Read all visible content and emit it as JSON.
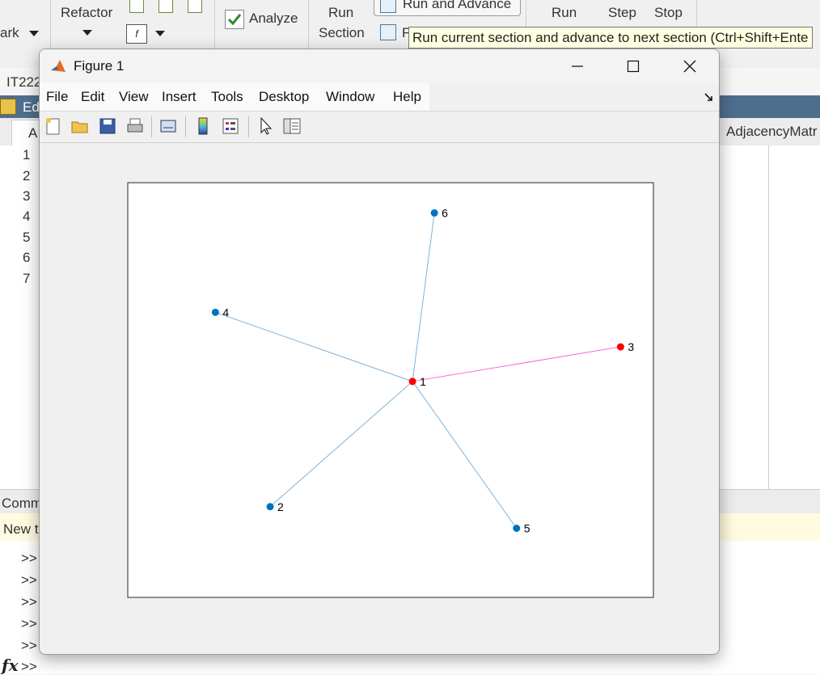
{
  "toolstrip": {
    "partial_left_label": "ark",
    "refactor_label": "Refactor",
    "analyze_label": "Analyze",
    "run_section_label_line1": "Run",
    "run_section_label_line2": "Section",
    "run_and_advance_label": "Run and Advance",
    "partial_run_to_end": "F",
    "run_label": "Run",
    "step_label": "Step",
    "stop_label": "Stop"
  },
  "tooltip": {
    "text": "Run current section and advance to next section (Ctrl+Shift+Ente"
  },
  "editor": {
    "file_tab_partial": "IT222",
    "editor_title_partial": "Ed",
    "tab_partial": "A",
    "variable_partial": "AdjacencyMatr",
    "line_numbers": [
      "1",
      "2",
      "3",
      "4",
      "5",
      "6",
      "7"
    ]
  },
  "command_window": {
    "header_partial": "Comm",
    "banner_partial": "New t",
    "prompts": [
      ">>",
      ">>",
      ">>",
      ">>",
      ">>",
      ">>"
    ],
    "fx_label": "fx"
  },
  "figure": {
    "title": "Figure 1",
    "menus": [
      "File",
      "Edit",
      "View",
      "Insert",
      "Tools",
      "Desktop",
      "Window",
      "Help"
    ],
    "toolbar_icons": [
      "new-figure-icon",
      "open-file-icon",
      "save-icon",
      "print-icon",
      "link-plot-icon",
      "colorbar-icon",
      "legend-icon",
      "pointer-icon",
      "property-editor-icon"
    ]
  },
  "chart_data": {
    "type": "graph",
    "xlim": [
      -2.6,
      2.2
    ],
    "ylim": [
      -2.5,
      2.3
    ],
    "nodes": [
      {
        "id": "1",
        "x": 0.0,
        "y": 0.0,
        "color": "#ff0000"
      },
      {
        "id": "2",
        "x": -1.3,
        "y": -1.45,
        "color": "#0072bd"
      },
      {
        "id": "3",
        "x": 1.9,
        "y": 0.4,
        "color": "#ff0000"
      },
      {
        "id": "4",
        "x": -1.8,
        "y": 0.8,
        "color": "#0072bd"
      },
      {
        "id": "5",
        "x": 0.95,
        "y": -1.7,
        "color": "#0072bd"
      },
      {
        "id": "6",
        "x": 0.2,
        "y": 1.95,
        "color": "#0072bd"
      }
    ],
    "edges": [
      {
        "source": "1",
        "target": "2",
        "color": "#7fb4d8"
      },
      {
        "source": "1",
        "target": "3",
        "color": "#ff66cc"
      },
      {
        "source": "1",
        "target": "4",
        "color": "#7fb4d8"
      },
      {
        "source": "1",
        "target": "5",
        "color": "#7fb4d8"
      },
      {
        "source": "1",
        "target": "6",
        "color": "#7fb4d8"
      }
    ]
  }
}
